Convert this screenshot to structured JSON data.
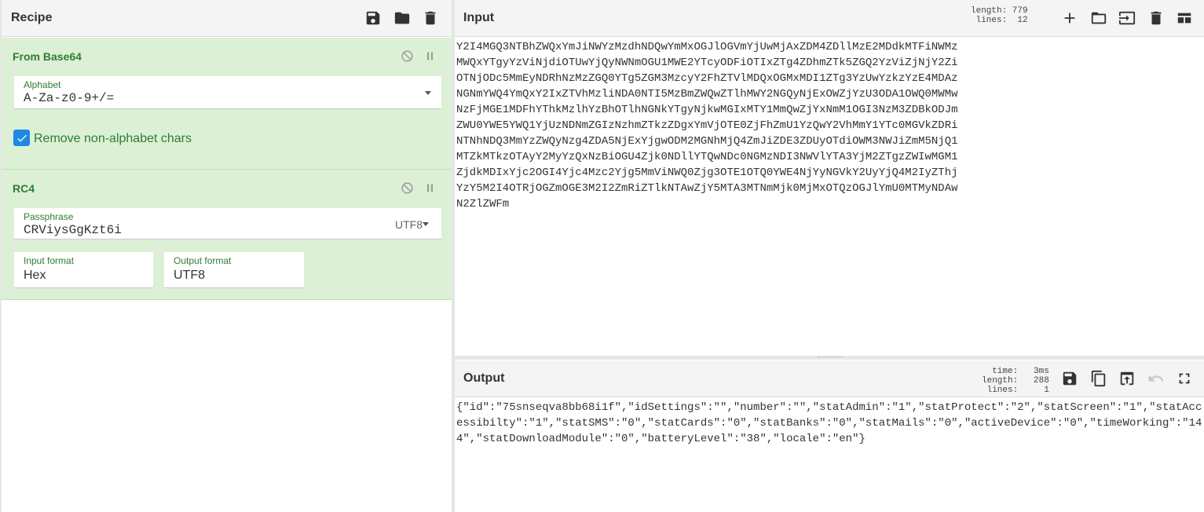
{
  "recipe": {
    "title": "Recipe",
    "icons": [
      "save-icon",
      "folder-icon",
      "trash-icon"
    ],
    "operations": [
      {
        "name": "From Base64",
        "alphabet_label": "Alphabet",
        "alphabet_value": "A-Za-z0-9+/=",
        "remove_label": "Remove non-alphabet chars",
        "remove_checked": true
      },
      {
        "name": "RC4",
        "passphrase_label": "Passphrase",
        "passphrase_value": "CRViysGgKzt6i",
        "passphrase_encoding": "UTF8",
        "input_format_label": "Input format",
        "input_format_value": "Hex",
        "output_format_label": "Output format",
        "output_format_value": "UTF8"
      }
    ]
  },
  "input": {
    "title": "Input",
    "stats": "length: 779\n lines:  12",
    "text": "Y2I4MGQ3NTBhZWQxYmJiNWYzMzdhNDQwYmMxOGJlOGVmYjUwMjAxZDM4ZDllMzE2MDdkMTFiNWMz\nMWQxYTgyYzViNjdiOTUwYjQyNWNmOGU1MWE2YTcyODFiOTIxZTg4ZDhmZTk5ZGQ2YzViZjNjY2Zi\nOTNjODc5MmEyNDRhNzMzZGQ0YTg5ZGM3MzcyY2FhZTVlMDQxOGMxMDI1ZTg3YzUwYzkzYzE4MDAz\nNGNmYWQ4YmQxY2IxZTVhMzliNDA0NTI5MzBmZWQwZTlhMWY2NGQyNjExOWZjYzU3ODA1OWQ0MWMw\nNzFjMGE1MDFhYThkMzlhYzBhOTlhNGNkYTgyNjkwMGIxMTY1MmQwZjYxNmM1OGI3NzM3ZDBkODJm\nZWU0YWE5YWQ1YjUzNDNmZGIzNzhmZTkzZDgxYmVjOTE0ZjFhZmU1YzQwY2VhMmY1YTc0MGVkZDRi\nNTNhNDQ3MmYzZWQyNzg4ZDA5NjExYjgwODM2MGNhMjQ4ZmJiZDE3ZDUyOTdiOWM3NWJiZmM5NjQ1\nMTZkMTkzOTAyY2MyYzQxNzBiOGU4Zjk0NDllYTQwNDc0NGMzNDI3NWVlYTA3YjM2ZTgzZWIwMGM1\nZjdkMDIxYjc2OGI4Yjc4Mzc2Yjg5MmViNWQ0Zjg3OTE1OTQ0YWE4NjYyNGVkY2UyYjQ4M2IyZThj\nYzY5M2I4OTRjOGZmOGE3M2I2ZmRiZTlkNTAwZjY5MTA3MTNmMjk0MjMxOTQzOGJlYmU0MTMyNDAw\nN2ZlZWFm"
  },
  "output": {
    "title": "Output",
    "stats": "  time:   3ms\nlength:   288\n lines:     1",
    "text": "{\"id\":\"75snseqva8bb68i1f\",\"idSettings\":\"\",\"number\":\"\",\"statAdmin\":\"1\",\"statProtect\":\"2\",\"statScreen\":\"1\",\"statAccessibilty\":\"1\",\"statSMS\":\"0\",\"statCards\":\"0\",\"statBanks\":\"0\",\"statMails\":\"0\",\"activeDevice\":\"0\",\"timeWorking\":\"144\",\"statDownloadModule\":\"0\",\"batteryLevel\":\"38\",\"locale\":\"en\"}"
  },
  "colors": {
    "operation_bg": "#dcf0d6",
    "operation_text": "#2e7d32",
    "checkbox": "#1e88e5"
  }
}
